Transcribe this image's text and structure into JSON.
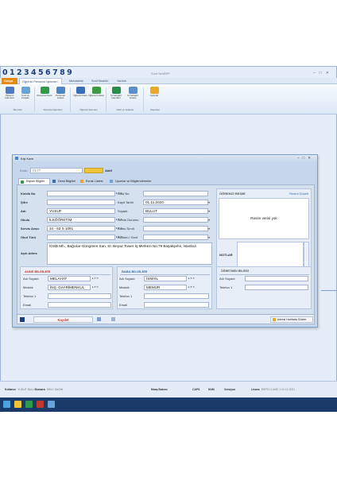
{
  "app": {
    "digits": "0123456789",
    "title": "Sınıf NetERP"
  },
  "menu": {
    "file": "Dosya",
    "tabs": [
      "Öğrenci Personel İşlemleri",
      "Muhasebe",
      "Sınıf Modülü",
      "Yardım"
    ]
  },
  "ribbon": {
    "buttons": [
      "Öğrenci İşlemleri",
      "Sınıf ve Kroşları",
      "Personel Kartı",
      "Personel Listesi",
      "Öğrenci Kartı",
      "Öğrenci Listesi",
      "Ücret/gelir İşlemleri",
      "Ücret/gelir Listesi",
      "Uyarılar"
    ],
    "groups": [
      "Tanımlar",
      "Personel İşlemleri",
      "Öğrenci İşlemleri",
      "Gelir ve Giderler",
      "Raporlar"
    ]
  },
  "dialog": {
    "title": "Kişi Kartı",
    "kodu_label": "Kodu",
    "kodu_value": "0177",
    "aktif": "Aktif",
    "tabs": [
      "Kişisel Bilgiler",
      "Dersi Bilgileri",
      "Evrak Listesi",
      "Uyarılar ve Bilgilendirmeler"
    ],
    "left": {
      "fields": [
        {
          "label": "Kimlik No",
          "value": ""
        },
        {
          "label": "Şifre",
          "value": ""
        },
        {
          "label": "Adı",
          "value": "YUSUF"
        },
        {
          "label": "Okulu",
          "value": "İLKÖĞRETİM"
        },
        {
          "label": "Servis Aracı",
          "value": "34 - 63 S 1091"
        },
        {
          "label": "Okul Türü",
          "value": ""
        }
      ],
      "adres_label": "Açık Adres",
      "adres": "İOSB Mh., Bağcılar-Güngören San. St. Beyaz Tower İş Merkezi No:79 Başakşehir, İstanbul"
    },
    "mid": {
      "fields": [
        {
          "label": "Okul No",
          "value": ""
        },
        {
          "label": "Kayıt Tarihi",
          "value": "01.11.2020"
        },
        {
          "label": "Soyadı",
          "value": "BULUT"
        },
        {
          "label": "Servis Durumu",
          "value": ""
        },
        {
          "label": "Kamu Sınıfı",
          "value": ""
        },
        {
          "label": "Bölümü / Sınıf",
          "value": ""
        }
      ]
    },
    "photo": {
      "title": "ÖĞRENCİ RESMİ",
      "change": "Resmi Düzelt",
      "empty": "Resim verisi yok",
      "notlar": "NOTLAR"
    },
    "anne": {
      "title": "ANNE BİLGİLERİ",
      "fields": [
        {
          "label": "Adı Soyadı",
          "value": "MELAHAT"
        },
        {
          "label": "Meslek",
          "value": "İNŞ. GAYRİMENKUL"
        },
        {
          "label": "Telefon 1",
          "value": ""
        },
        {
          "label": "Email",
          "value": ""
        }
      ]
    },
    "baba": {
      "title": "BABA BİLGİLERİ",
      "fields": [
        {
          "label": "Adı Soyadı",
          "value": "İSMAİL"
        },
        {
          "label": "Meslek",
          "value": "MEMUR"
        },
        {
          "label": "Telefon 1",
          "value": ""
        },
        {
          "label": "Email",
          "value": ""
        }
      ]
    },
    "ogretmen": {
      "title": "ÖĞRETMEN BİLGİSİ",
      "fields": [
        {
          "label": "Adı Soyadı",
          "value": ""
        },
        {
          "label": "Telefon 1",
          "value": ""
        }
      ]
    },
    "footer": {
      "save": "Kaydet",
      "map": "Adresi Haritada Göster"
    }
  },
  "status": {
    "items": [
      {
        "label": "Kullanıcı",
        "value": "YUSUF BULUT"
      },
      {
        "label": "Numara",
        "value": "3904 / 5A/2W"
      },
      {
        "label": "Maaş Bakımı",
        "value": ""
      },
      {
        "label": "CAPS",
        "value": ""
      },
      {
        "label": "NUM",
        "value": ""
      },
      {
        "label": "Versiyon",
        "value": ""
      },
      {
        "label": "Lisans",
        "value": "ERPO LCASE 1 01.12.2021"
      }
    ]
  },
  "colors": {
    "accent": "#e58a15",
    "section_red": "#c0392b",
    "section_blue": "#3a6db5",
    "dialog": "#c6d6ec"
  }
}
